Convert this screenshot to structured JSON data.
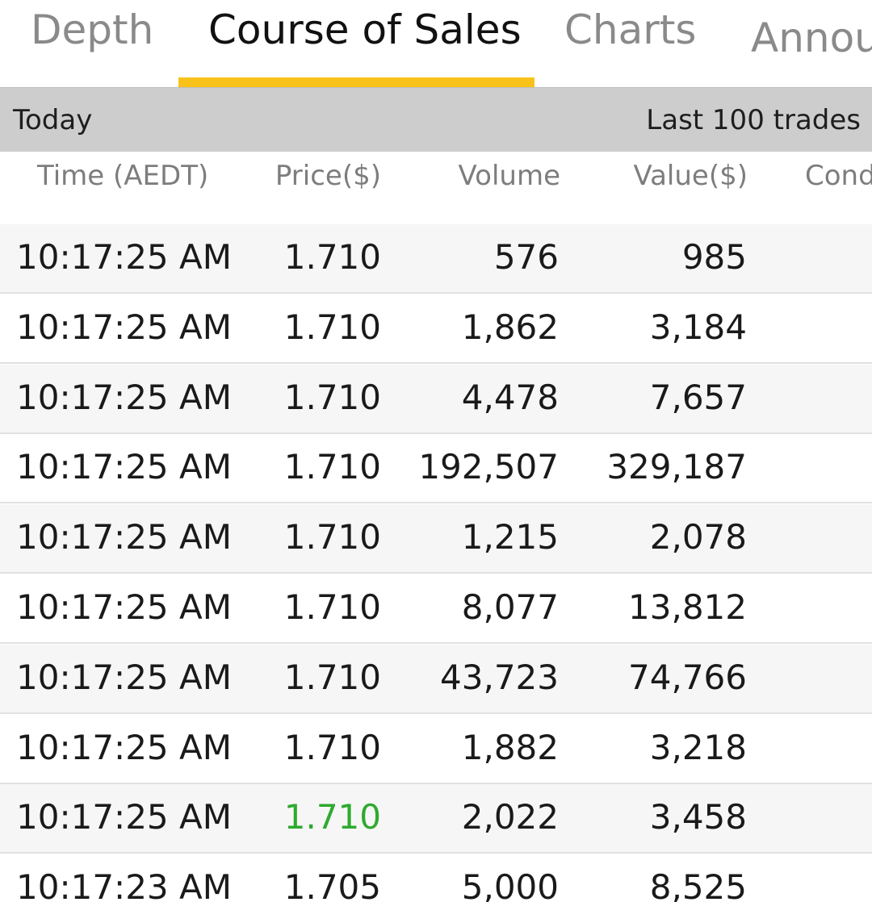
{
  "tabs": [
    {
      "label": "Depth",
      "active": false
    },
    {
      "label": "Course of Sales",
      "active": true
    },
    {
      "label": "Charts",
      "active": false
    },
    {
      "label": "Annou",
      "active": false
    }
  ],
  "colors": {
    "accent": "#f9c21a",
    "price_up": "#2eaa2e",
    "summary_bar": "#cdcdcd"
  },
  "summary": {
    "left": "Today",
    "right": "Last 100 trades"
  },
  "columns": {
    "time": "Time (AEDT)",
    "price": "Price($)",
    "volume": "Volume",
    "value": "Value($)",
    "condition": "Cond"
  },
  "trades": [
    {
      "time": "10:17:25 AM",
      "price": "1.710",
      "volume": "576",
      "value": "985"
    },
    {
      "time": "10:17:25 AM",
      "price": "1.710",
      "volume": "1,862",
      "value": "3,184"
    },
    {
      "time": "10:17:25 AM",
      "price": "1.710",
      "volume": "4,478",
      "value": "7,657"
    },
    {
      "time": "10:17:25 AM",
      "price": "1.710",
      "volume": "192,507",
      "value": "329,187"
    },
    {
      "time": "10:17:25 AM",
      "price": "1.710",
      "volume": "1,215",
      "value": "2,078"
    },
    {
      "time": "10:17:25 AM",
      "price": "1.710",
      "volume": "8,077",
      "value": "13,812"
    },
    {
      "time": "10:17:25 AM",
      "price": "1.710",
      "volume": "43,723",
      "value": "74,766"
    },
    {
      "time": "10:17:25 AM",
      "price": "1.710",
      "volume": "1,882",
      "value": "3,218"
    },
    {
      "time": "10:17:25 AM",
      "price": "1.710",
      "volume": "2,022",
      "value": "3,458",
      "price_direction": "up"
    },
    {
      "time": "10:17:23 AM",
      "price": "1.705",
      "volume": "5,000",
      "value": "8,525"
    }
  ]
}
